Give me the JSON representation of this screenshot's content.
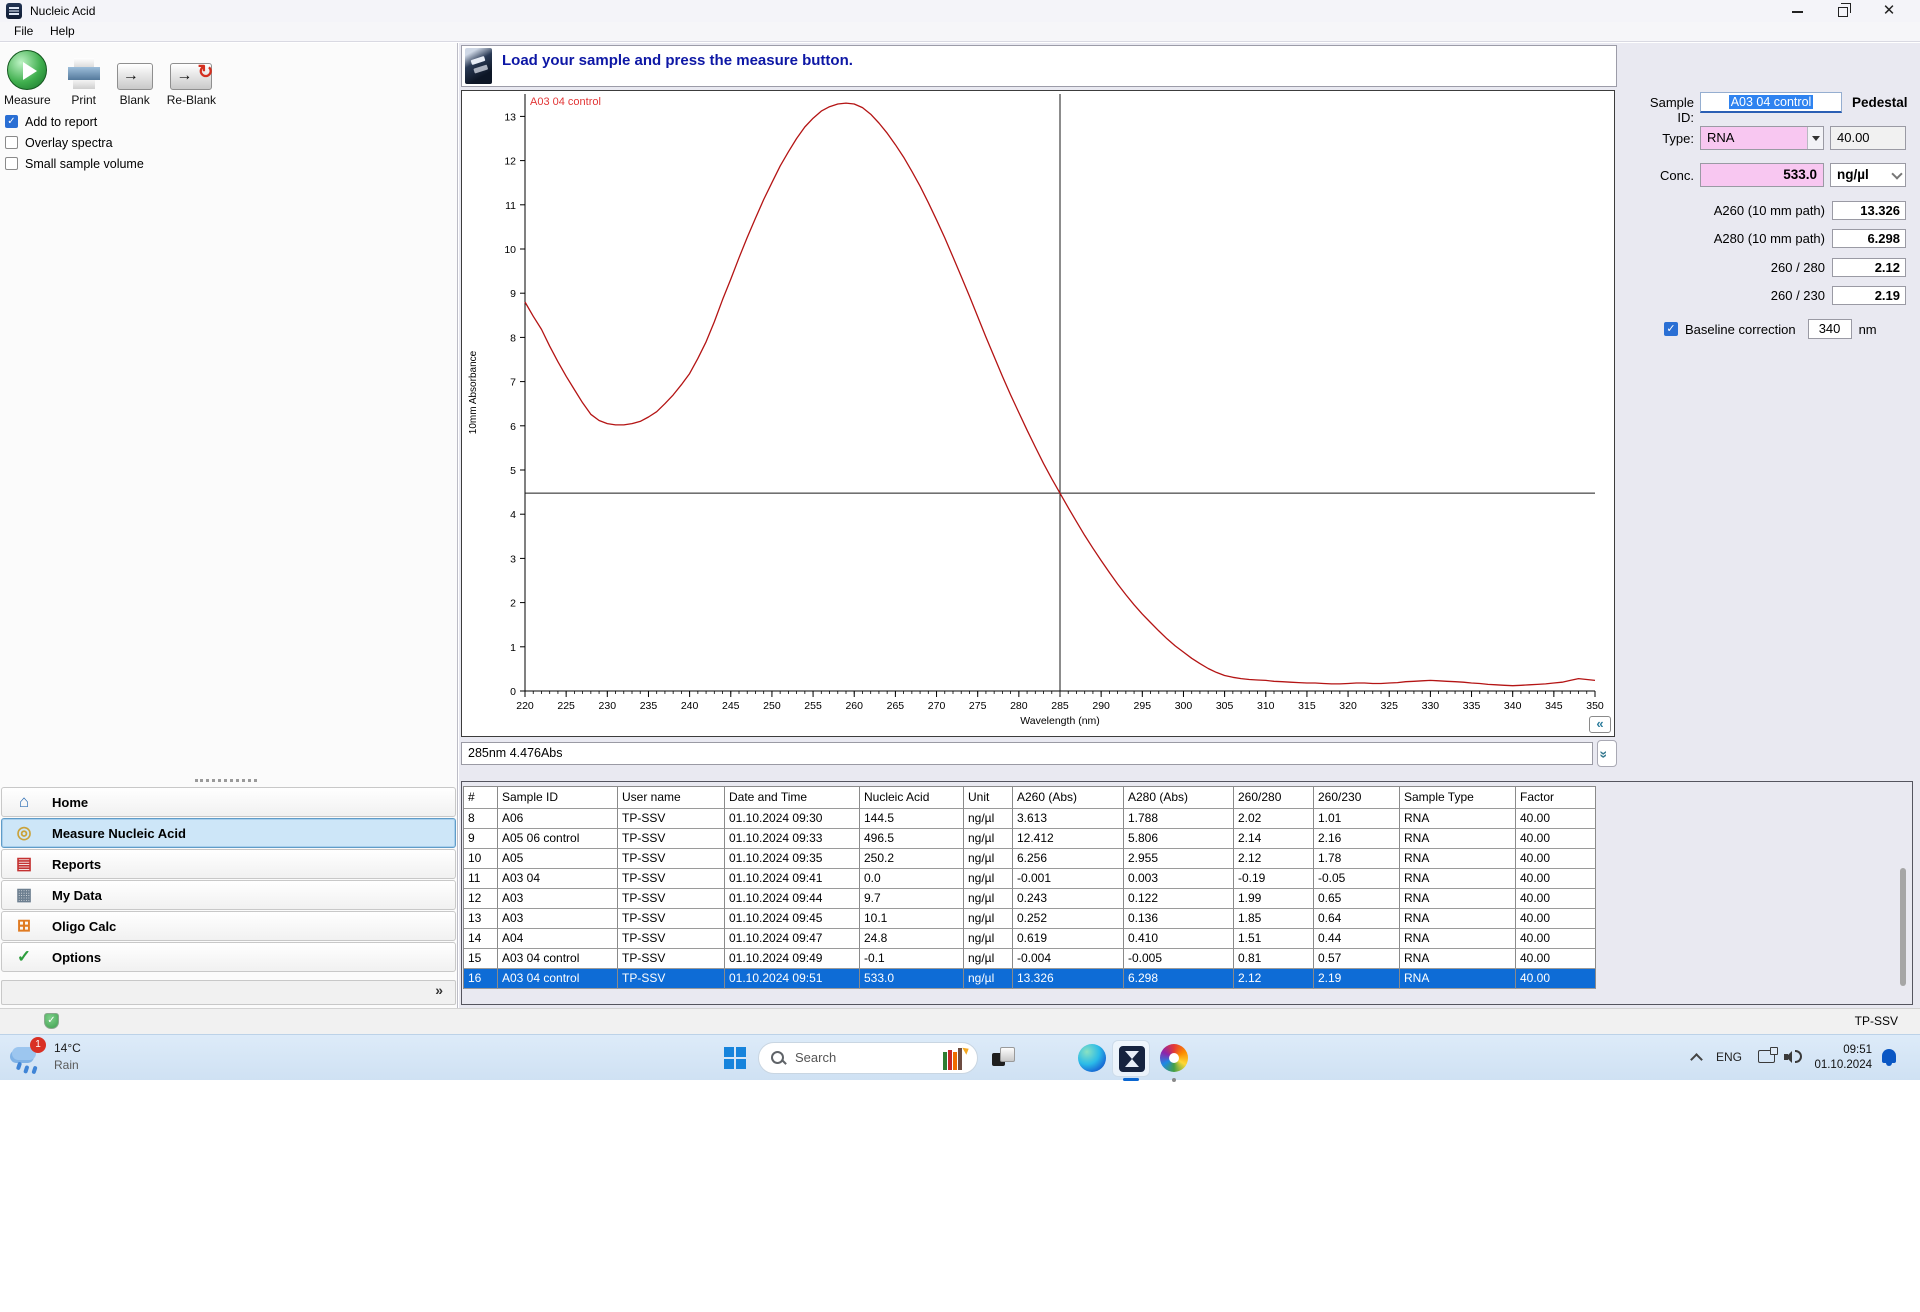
{
  "window": {
    "title": "Nucleic Acid"
  },
  "menu": {
    "items": [
      "File",
      "Help"
    ]
  },
  "toolbar": {
    "buttons": [
      {
        "id": "measure",
        "label": "Measure"
      },
      {
        "id": "print",
        "label": "Print"
      },
      {
        "id": "blank",
        "label": "Blank"
      },
      {
        "id": "reblank",
        "label": "Re-Blank"
      }
    ]
  },
  "options_checkboxes": [
    {
      "label": "Add to report",
      "checked": true
    },
    {
      "label": "Overlay spectra",
      "checked": false
    },
    {
      "label": "Small sample volume",
      "checked": false
    }
  ],
  "sidebar": {
    "items": [
      {
        "id": "home",
        "label": "Home",
        "selected": false
      },
      {
        "id": "measure",
        "label": "Measure Nucleic Acid",
        "selected": true
      },
      {
        "id": "reports",
        "label": "Reports",
        "selected": false
      },
      {
        "id": "mydata",
        "label": "My Data",
        "selected": false
      },
      {
        "id": "oligo",
        "label": "Oligo Calc",
        "selected": false
      },
      {
        "id": "options",
        "label": "Options",
        "selected": false
      }
    ],
    "collapse_glyph": "»"
  },
  "message_bar": {
    "text": "Load your sample and press the measure button."
  },
  "sample_panel": {
    "sample_id_label": "Sample ID:",
    "sample_id_value": "A03 04 control",
    "mode_label": "Pedestal",
    "type_label": "Type:",
    "type_value": "RNA",
    "factor_value": "40.00",
    "conc_label": "Conc.",
    "conc_value": "533.0",
    "conc_unit": "ng/µl",
    "rows": [
      {
        "label": "A260 (10 mm path)",
        "value": "13.326"
      },
      {
        "label": "A280 (10 mm path)",
        "value": "6.298"
      },
      {
        "label": "260 / 280",
        "value": "2.12"
      },
      {
        "label": "260 / 230",
        "value": "2.19"
      }
    ],
    "baseline": {
      "label": "Baseline correction",
      "checked": true,
      "value": "340",
      "unit": "nm"
    }
  },
  "chart_status": {
    "text": "285nm 4.476Abs",
    "collapse_glyph": "»",
    "pan_glyph": "«"
  },
  "chart_data": {
    "type": "line",
    "series_label": "A03 04 control",
    "xlabel": "Wavelength (nm)",
    "ylabel": "10mm Absorbance",
    "xlim": [
      220,
      350
    ],
    "ylim": [
      0,
      13.4
    ],
    "xtick_major": 5,
    "xtick_minor": 1,
    "ytick_major": 1,
    "grid": false,
    "crosshair": {
      "x": 285,
      "y": 4.476
    },
    "line_color": "#b41414",
    "label_color": "#e23535",
    "points": [
      [
        220,
        8.8
      ],
      [
        221,
        8.48
      ],
      [
        222,
        8.18
      ],
      [
        223,
        7.8
      ],
      [
        224,
        7.45
      ],
      [
        225,
        7.12
      ],
      [
        226,
        6.82
      ],
      [
        227,
        6.52
      ],
      [
        228,
        6.26
      ],
      [
        229,
        6.12
      ],
      [
        230,
        6.05
      ],
      [
        231,
        6.02
      ],
      [
        232,
        6.02
      ],
      [
        233,
        6.05
      ],
      [
        234,
        6.1
      ],
      [
        235,
        6.2
      ],
      [
        236,
        6.32
      ],
      [
        237,
        6.5
      ],
      [
        238,
        6.7
      ],
      [
        239,
        6.93
      ],
      [
        240,
        7.18
      ],
      [
        241,
        7.52
      ],
      [
        242,
        7.9
      ],
      [
        243,
        8.35
      ],
      [
        244,
        8.85
      ],
      [
        245,
        9.32
      ],
      [
        246,
        9.8
      ],
      [
        247,
        10.26
      ],
      [
        248,
        10.7
      ],
      [
        249,
        11.12
      ],
      [
        250,
        11.5
      ],
      [
        251,
        11.88
      ],
      [
        252,
        12.2
      ],
      [
        253,
        12.5
      ],
      [
        254,
        12.76
      ],
      [
        255,
        12.96
      ],
      [
        256,
        13.12
      ],
      [
        257,
        13.22
      ],
      [
        258,
        13.28
      ],
      [
        259,
        13.3
      ],
      [
        260,
        13.28
      ],
      [
        261,
        13.2
      ],
      [
        262,
        13.05
      ],
      [
        263,
        12.85
      ],
      [
        264,
        12.62
      ],
      [
        265,
        12.36
      ],
      [
        266,
        12.08
      ],
      [
        267,
        11.76
      ],
      [
        268,
        11.42
      ],
      [
        269,
        11.05
      ],
      [
        270,
        10.66
      ],
      [
        271,
        10.25
      ],
      [
        272,
        9.82
      ],
      [
        273,
        9.38
      ],
      [
        274,
        8.93
      ],
      [
        275,
        8.47
      ],
      [
        276,
        8.01
      ],
      [
        277,
        7.56
      ],
      [
        278,
        7.12
      ],
      [
        279,
        6.7
      ],
      [
        280,
        6.3
      ],
      [
        281,
        5.9
      ],
      [
        282,
        5.52
      ],
      [
        283,
        5.15
      ],
      [
        284,
        4.8
      ],
      [
        285,
        4.476
      ],
      [
        286,
        4.15
      ],
      [
        287,
        3.83
      ],
      [
        288,
        3.52
      ],
      [
        289,
        3.23
      ],
      [
        290,
        2.95
      ],
      [
        291,
        2.68
      ],
      [
        292,
        2.42
      ],
      [
        293,
        2.18
      ],
      [
        294,
        1.95
      ],
      [
        295,
        1.74
      ],
      [
        296,
        1.55
      ],
      [
        297,
        1.36
      ],
      [
        298,
        1.18
      ],
      [
        299,
        1.02
      ],
      [
        300,
        0.88
      ],
      [
        301,
        0.74
      ],
      [
        302,
        0.62
      ],
      [
        303,
        0.51
      ],
      [
        304,
        0.42
      ],
      [
        305,
        0.35
      ],
      [
        306,
        0.31
      ],
      [
        307,
        0.28
      ],
      [
        308,
        0.26
      ],
      [
        309,
        0.25
      ],
      [
        310,
        0.24
      ],
      [
        311,
        0.22
      ],
      [
        312,
        0.21
      ],
      [
        313,
        0.2
      ],
      [
        314,
        0.19
      ],
      [
        315,
        0.18
      ],
      [
        316,
        0.18
      ],
      [
        317,
        0.17
      ],
      [
        318,
        0.16
      ],
      [
        319,
        0.16
      ],
      [
        320,
        0.17
      ],
      [
        321,
        0.18
      ],
      [
        322,
        0.18
      ],
      [
        323,
        0.17
      ],
      [
        324,
        0.17
      ],
      [
        325,
        0.18
      ],
      [
        326,
        0.19
      ],
      [
        327,
        0.21
      ],
      [
        328,
        0.22
      ],
      [
        329,
        0.23
      ],
      [
        330,
        0.24
      ],
      [
        331,
        0.23
      ],
      [
        332,
        0.22
      ],
      [
        333,
        0.21
      ],
      [
        334,
        0.2
      ],
      [
        335,
        0.18
      ],
      [
        336,
        0.17
      ],
      [
        337,
        0.15
      ],
      [
        338,
        0.14
      ],
      [
        339,
        0.13
      ],
      [
        340,
        0.12
      ],
      [
        341,
        0.13
      ],
      [
        342,
        0.14
      ],
      [
        343,
        0.15
      ],
      [
        344,
        0.16
      ],
      [
        345,
        0.18
      ],
      [
        346,
        0.2
      ],
      [
        347,
        0.24
      ],
      [
        348,
        0.28
      ],
      [
        349,
        0.26
      ],
      [
        350,
        0.24
      ]
    ]
  },
  "table": {
    "columns": [
      "#",
      "Sample ID",
      "User name",
      "Date and Time",
      "Nucleic Acid",
      "Unit",
      "A260 (Abs)",
      "A280 (Abs)",
      "260/280",
      "260/230",
      "Sample Type",
      "Factor"
    ],
    "rows": [
      {
        "cells": [
          "8",
          "A06",
          "TP-SSV",
          "01.10.2024 09:30",
          "144.5",
          "ng/µl",
          "3.613",
          "1.788",
          "2.02",
          "1.01",
          "RNA",
          "40.00"
        ],
        "selected": false
      },
      {
        "cells": [
          "9",
          "A05 06 control",
          "TP-SSV",
          "01.10.2024 09:33",
          "496.5",
          "ng/µl",
          "12.412",
          "5.806",
          "2.14",
          "2.16",
          "RNA",
          "40.00"
        ],
        "selected": false
      },
      {
        "cells": [
          "10",
          "A05",
          "TP-SSV",
          "01.10.2024 09:35",
          "250.2",
          "ng/µl",
          "6.256",
          "2.955",
          "2.12",
          "1.78",
          "RNA",
          "40.00"
        ],
        "selected": false
      },
      {
        "cells": [
          "11",
          "A03 04",
          "TP-SSV",
          "01.10.2024 09:41",
          "0.0",
          "ng/µl",
          "-0.001",
          "0.003",
          "-0.19",
          "-0.05",
          "RNA",
          "40.00"
        ],
        "selected": false
      },
      {
        "cells": [
          "12",
          "A03",
          "TP-SSV",
          "01.10.2024 09:44",
          "9.7",
          "ng/µl",
          "0.243",
          "0.122",
          "1.99",
          "0.65",
          "RNA",
          "40.00"
        ],
        "selected": false
      },
      {
        "cells": [
          "13",
          "A03",
          "TP-SSV",
          "01.10.2024 09:45",
          "10.1",
          "ng/µl",
          "0.252",
          "0.136",
          "1.85",
          "0.64",
          "RNA",
          "40.00"
        ],
        "selected": false
      },
      {
        "cells": [
          "14",
          "A04",
          "TP-SSV",
          "01.10.2024 09:47",
          "24.8",
          "ng/µl",
          "0.619",
          "0.410",
          "1.51",
          "0.44",
          "RNA",
          "40.00"
        ],
        "selected": false
      },
      {
        "cells": [
          "15",
          "A03 04 control",
          "TP-SSV",
          "01.10.2024 09:49",
          "-0.1",
          "ng/µl",
          "-0.004",
          "-0.005",
          "0.81",
          "0.57",
          "RNA",
          "40.00"
        ],
        "selected": false
      },
      {
        "cells": [
          "16",
          "A03 04 control",
          "TP-SSV",
          "01.10.2024 09:51",
          "533.0",
          "ng/µl",
          "13.326",
          "6.298",
          "2.12",
          "2.19",
          "RNA",
          "40.00"
        ],
        "selected": true
      }
    ]
  },
  "status_bar": {
    "user": "TP-SSV"
  },
  "taskbar": {
    "weather": {
      "badge": "1",
      "temp": "14°C",
      "condition": "Rain"
    },
    "search": {
      "placeholder": "Search"
    },
    "tray": {
      "lang": "ENG",
      "time": "09:51",
      "date": "01.10.2024"
    }
  }
}
